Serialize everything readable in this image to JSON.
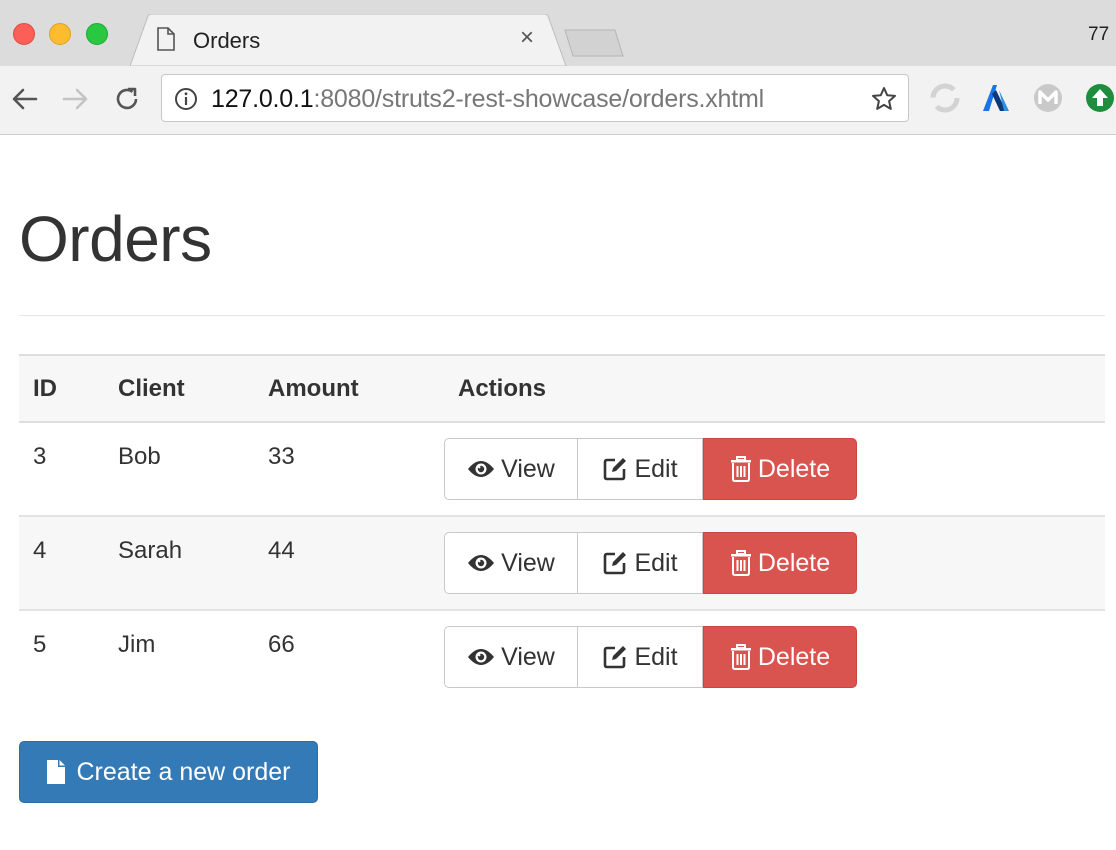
{
  "browser": {
    "tab_title": "Orders",
    "tab_close": "×",
    "top_right_text": "77",
    "url_host": "127.0.0.1",
    "url_rest": ":8080/struts2-rest-showcase/orders.xhtml",
    "extensions": [
      "sync-icon",
      "lambda-extension-icon",
      "m-extension-icon",
      "upload-extension-icon"
    ]
  },
  "page": {
    "title": "Orders",
    "table": {
      "headers": [
        "ID",
        "Client",
        "Amount",
        "Actions"
      ],
      "rows": [
        {
          "id": "3",
          "client": "Bob",
          "amount": "33"
        },
        {
          "id": "4",
          "client": "Sarah",
          "amount": "44"
        },
        {
          "id": "5",
          "client": "Jim",
          "amount": "66"
        }
      ],
      "actions": {
        "view": "View",
        "edit": "Edit",
        "delete": "Delete"
      }
    },
    "create_button": "Create a new order"
  },
  "colors": {
    "danger": "#d9534f",
    "primary": "#337ab7"
  }
}
